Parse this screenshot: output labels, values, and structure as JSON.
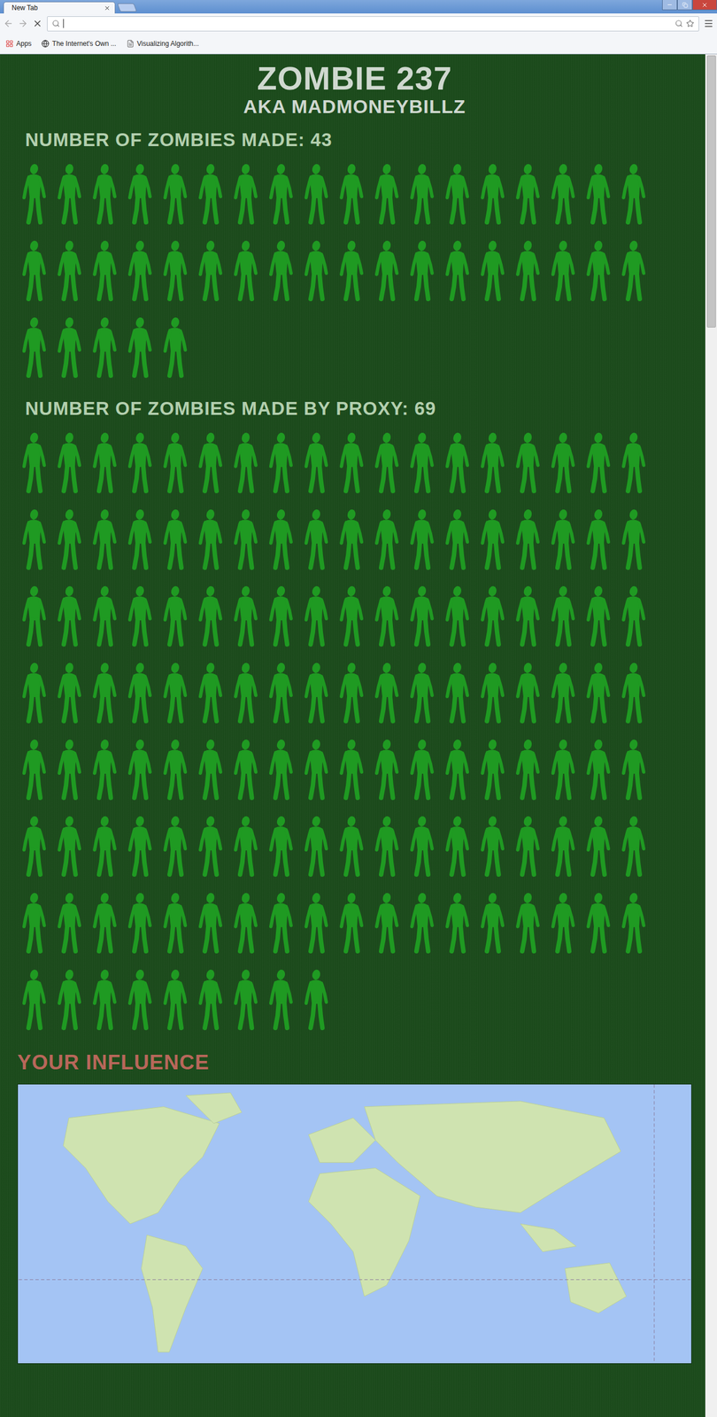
{
  "browser": {
    "tabs": [
      {
        "label": "New Tab",
        "selected": true
      }
    ],
    "address": {
      "value": ""
    },
    "bookmarks": [
      {
        "label": "Apps",
        "kind": "apps"
      },
      {
        "label": "The Internet's Own ...",
        "kind": "page"
      },
      {
        "label": "Visualizing Algorith...",
        "kind": "file"
      }
    ]
  },
  "page": {
    "title": "ZOMBIE 237",
    "subtitle": "AKA MADMONEYBILLZ",
    "groups": [
      {
        "label": "NUMBER OF ZOMBIES MADE:",
        "count": "43",
        "icons": 41
      },
      {
        "label": "NUMBER OF ZOMBIES MADE BY PROXY:",
        "count": "69",
        "icons": 135
      }
    ],
    "influence": {
      "title": "YOUR INFLUENCE"
    }
  },
  "scrollbar": {
    "level": 0.2
  }
}
